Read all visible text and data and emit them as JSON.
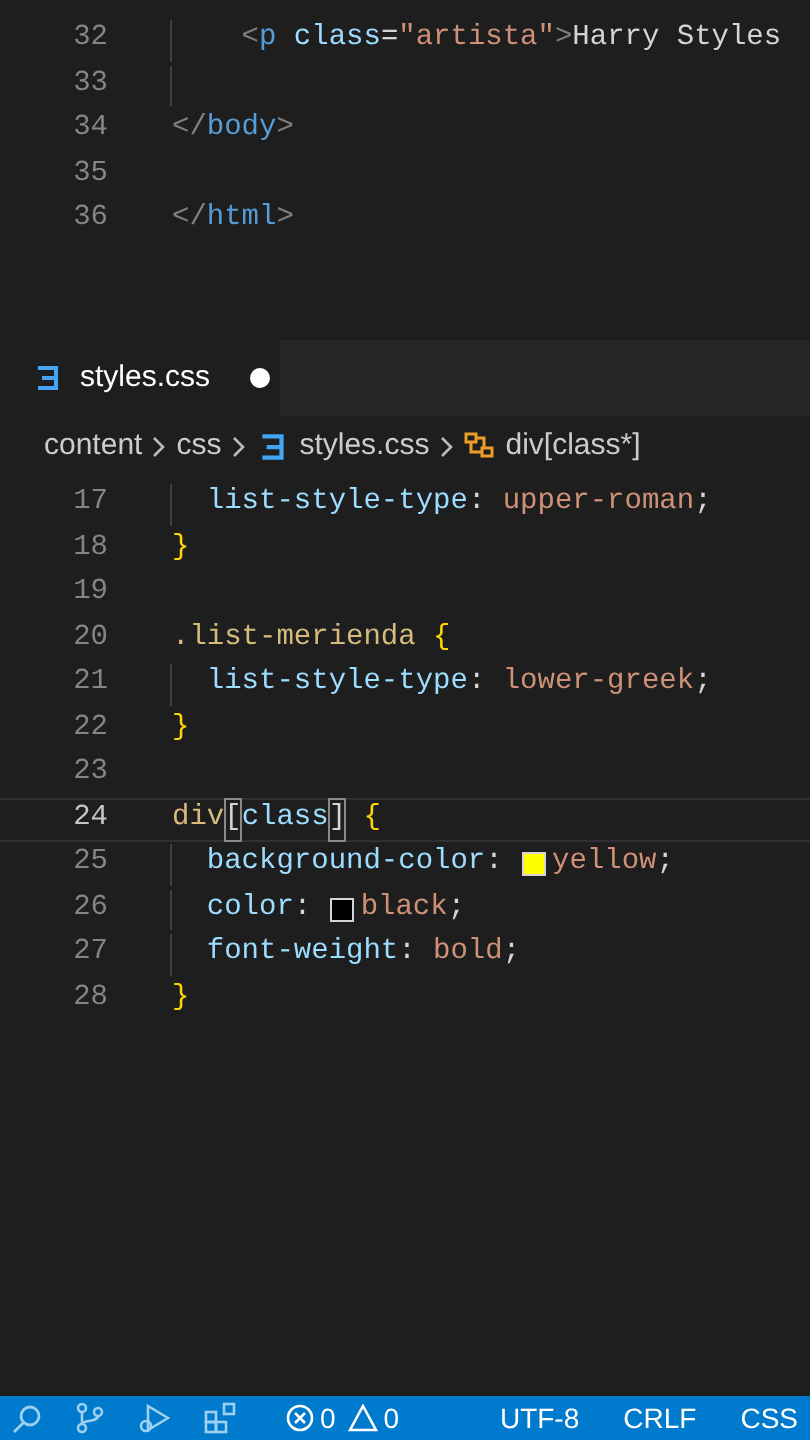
{
  "top_editor": {
    "lines": [
      {
        "number": "32",
        "current": false,
        "indent_guide": true,
        "tokens": [
          {
            "kind": "tag-bracket",
            "text": "    <"
          },
          {
            "kind": "tag",
            "text": "p"
          },
          {
            "kind": "attr",
            "text": " class"
          },
          {
            "kind": "text",
            "text": "="
          },
          {
            "kind": "string",
            "text": "\"artista\""
          },
          {
            "kind": "tag-bracket",
            "text": ">"
          },
          {
            "kind": "text",
            "text": "Harry Styles"
          }
        ]
      },
      {
        "number": "33",
        "current": false,
        "indent_guide": true
      },
      {
        "number": "34",
        "current": false,
        "indent_guide": false,
        "tokens": [
          {
            "kind": "tag-bracket",
            "text": "</"
          },
          {
            "kind": "tag",
            "text": "body"
          },
          {
            "kind": "tag-bracket",
            "text": ">"
          }
        ]
      },
      {
        "number": "35",
        "current": false,
        "indent_guide": false
      },
      {
        "number": "36",
        "current": false,
        "indent_guide": false,
        "tokens": [
          {
            "kind": "tag-bracket",
            "text": "</"
          },
          {
            "kind": "tag",
            "text": "html"
          },
          {
            "kind": "tag-bracket",
            "text": ">"
          }
        ]
      }
    ]
  },
  "tab": {
    "label": "styles.css",
    "dirty": true
  },
  "breadcrumb": [
    {
      "kind": "folder",
      "label": "content"
    },
    {
      "kind": "folder",
      "label": "css"
    },
    {
      "kind": "file",
      "label": "styles.css"
    },
    {
      "kind": "symbol",
      "label": "div[class*]"
    }
  ],
  "editor": {
    "lines": [
      {
        "number": "17",
        "current": false,
        "indent_guide": true,
        "tokens": [
          {
            "kind": "property",
            "text": "  list-style-type"
          },
          {
            "kind": "punct",
            "text": ": "
          },
          {
            "kind": "value",
            "text": "upper-roman"
          },
          {
            "kind": "punct",
            "text": ";"
          }
        ]
      },
      {
        "number": "18",
        "current": false,
        "indent_guide": false,
        "tokens": [
          {
            "kind": "brace",
            "text": "}"
          }
        ]
      },
      {
        "number": "19",
        "current": false,
        "indent_guide": false
      },
      {
        "number": "20",
        "current": false,
        "indent_guide": false,
        "tokens": [
          {
            "kind": "selector",
            "text": ".list-merienda "
          },
          {
            "kind": "brace",
            "text": "{"
          }
        ]
      },
      {
        "number": "21",
        "current": false,
        "indent_guide": true,
        "tokens": [
          {
            "kind": "property",
            "text": "  list-style-type"
          },
          {
            "kind": "punct",
            "text": ": "
          },
          {
            "kind": "value",
            "text": "lower-greek"
          },
          {
            "kind": "punct",
            "text": ";"
          }
        ]
      },
      {
        "number": "22",
        "current": false,
        "indent_guide": false,
        "tokens": [
          {
            "kind": "brace",
            "text": "}"
          }
        ]
      },
      {
        "number": "23",
        "current": false,
        "indent_guide": false
      },
      {
        "number": "24",
        "current": true,
        "indent_guide": false,
        "tokens": [
          {
            "kind": "selector",
            "text": "div"
          },
          {
            "kind": "bracket-match",
            "text": "["
          },
          {
            "kind": "property",
            "text": "class"
          },
          {
            "kind": "bracket-match",
            "text": "]"
          },
          {
            "kind": "brace",
            "text": " {"
          }
        ]
      },
      {
        "number": "25",
        "current": false,
        "indent_guide": true,
        "tokens": [
          {
            "kind": "property",
            "text": "  background-color"
          },
          {
            "kind": "punct",
            "text": ": "
          },
          {
            "kind": "swatch",
            "color": "#ffff00"
          },
          {
            "kind": "value",
            "text": "yellow"
          },
          {
            "kind": "punct",
            "text": ";"
          }
        ]
      },
      {
        "number": "26",
        "current": false,
        "indent_guide": true,
        "tokens": [
          {
            "kind": "property",
            "text": "  color"
          },
          {
            "kind": "punct",
            "text": ": "
          },
          {
            "kind": "swatch",
            "color": "#000000"
          },
          {
            "kind": "value",
            "text": "black"
          },
          {
            "kind": "punct",
            "text": ";"
          }
        ]
      },
      {
        "number": "27",
        "current": false,
        "indent_guide": true,
        "tokens": [
          {
            "kind": "property",
            "text": "  font-weight"
          },
          {
            "kind": "punct",
            "text": ": "
          },
          {
            "kind": "value",
            "text": "bold"
          },
          {
            "kind": "punct",
            "text": ";"
          }
        ]
      },
      {
        "number": "28",
        "current": false,
        "indent_guide": false,
        "tokens": [
          {
            "kind": "brace",
            "text": "}"
          }
        ]
      }
    ]
  },
  "status_bar": {
    "errors": "0",
    "warnings": "0",
    "encoding": "UTF-8",
    "eol": "CRLF",
    "language": "CSS"
  }
}
